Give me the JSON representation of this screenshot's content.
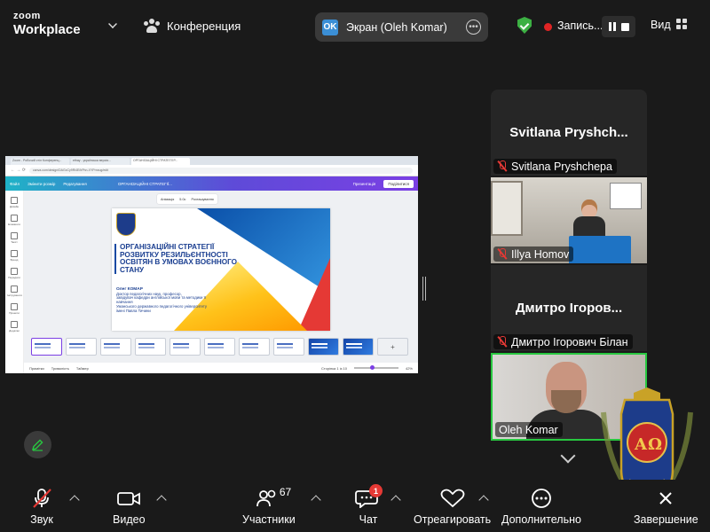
{
  "app": {
    "brand_top": "zoom",
    "brand_bottom": "Workplace"
  },
  "header": {
    "conference_label": "Конференция",
    "share_initials": "OK",
    "share_label": "Экран (Oleh Komar)",
    "record_label": "Запись...",
    "view_label": "Вид"
  },
  "shared_screen": {
    "tabs": [
      "Zoom - Робочий стіл Конференц...",
      "ethay - українська версія...",
      "ОРГАНІЗАЦІЙНІ СТРАТЕГІЇ Р..."
    ],
    "url": "canva.com/design/DAGcCy9Ri4E/hPhn-XYPrnxug/edit",
    "canva_menu": [
      "Файл",
      "Змінити розмір",
      "Редагування"
    ],
    "doc_title": "ОРГАНІЗАЦІЙНІ СТРАТЕГІЇ...",
    "present_label": "Презентація",
    "share_label": "Поділитися",
    "sidebar": [
      "Дизайн",
      "Елементи",
      "Текст",
      "Бренд",
      "Передати",
      "Інструменти",
      "Проекти",
      "Додатки"
    ],
    "toolbar": [
      "Анімація",
      "5.0с",
      "Розташування"
    ],
    "slide": {
      "title": "ОРГАНІЗАЦІЙНІ СТРАТЕГІЇ РОЗВИТКУ РЕЗИЛЬЄНТНОСТІ ОСВІТЯН В УМОВАХ ВОЄННОГО СТАНУ",
      "author": "Олег КОМАР",
      "author_lines": [
        "Доктор педагогічних наук, професор,",
        "завідувач кафедри англійської мови та методики її",
        "навчання",
        "Уманського державного педагогічного університету",
        "імені Павла Тичини"
      ]
    },
    "status": {
      "notes": "Примітки",
      "duration": "Тривалість",
      "timer": "Таймер",
      "page": "Сторінка 1 із 10",
      "zoom": "42%"
    }
  },
  "participants": [
    {
      "big_name": "Svitlana  Pryshch...",
      "name": "Svitlana Pryshchepa",
      "video": false
    },
    {
      "big_name": "",
      "name": "Illya Homov",
      "video": true
    },
    {
      "big_name": "Дмитро Ігоров...",
      "name": "Дмитро Ігорович Білан",
      "video": false
    },
    {
      "big_name": "",
      "name": "Oleh Komar",
      "video": true,
      "active_speaker": true
    }
  ],
  "controls": {
    "audio": "Звук",
    "video": "Видео",
    "participants": "Участники",
    "participants_count": "67",
    "chat": "Чат",
    "chat_badge": "1",
    "react": "Отреагировать",
    "more": "Дополнительно",
    "end": "Завершение"
  },
  "colors": {
    "accent_green": "#28c840",
    "record_red": "#e02424",
    "canva_purple": "#7b3fe4",
    "share_badge": "#3b8fd6"
  }
}
